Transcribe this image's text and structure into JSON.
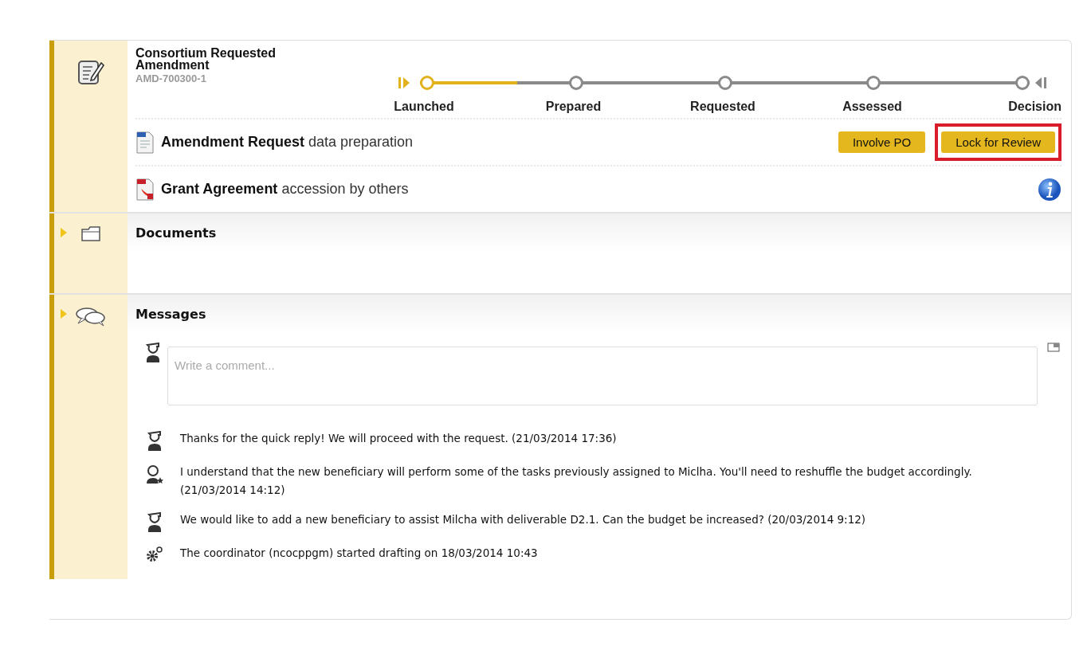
{
  "case": {
    "title": "Consortium Requested Amendment",
    "reference": "AMD-700300-1"
  },
  "timeline": {
    "level": 0.16,
    "steps": [
      {
        "label": "Launched",
        "reached": true
      },
      {
        "label": "Prepared",
        "reached": false
      },
      {
        "label": "Requested",
        "reached": false
      },
      {
        "label": "Assessed",
        "reached": false
      },
      {
        "label": "Decision",
        "reached": false
      }
    ]
  },
  "tasks": [
    {
      "kind": "form",
      "text": "**Amendment Request** data preparation"
    },
    {
      "kind": "pdf",
      "text": "**Grant Agreement** accession by others"
    }
  ],
  "buttons": [
    {
      "label": "Involve PO",
      "highlighted": false
    },
    {
      "label": "Lock for Review",
      "highlighted": true
    }
  ],
  "sections": [
    {
      "title": "Documents",
      "kind": "documents"
    },
    {
      "title": "Messages",
      "kind": "messages"
    }
  ],
  "comment": {
    "placeholder": "Write a comment..."
  },
  "messages": [
    {
      "kind": "user",
      "text": "Thanks for the quick reply! We will proceed with the request. (21/03/2014 17:36)"
    },
    {
      "kind": "officer",
      "text": "I understand that the new beneficiary will perform some of the tasks previously assigned to Miclha. You'll need to reshuffle the budget accordingly. (21/03/2014 14:12)"
    },
    {
      "kind": "user",
      "text": "We would like to add a new beneficiary to assist Milcha with deliverable D2.1. Can the budget be increased? (20/03/2014 9:12)"
    },
    {
      "kind": "system",
      "text": "The coordinator (ncocppgm) started drafting on 18/03/2014 10:43"
    }
  ]
}
